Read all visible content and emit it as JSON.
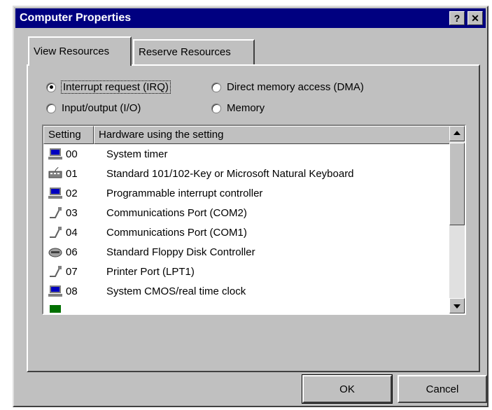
{
  "window": {
    "title": "Computer Properties",
    "help_label": "?",
    "close_label": "✕"
  },
  "tabs": [
    {
      "label": "View Resources",
      "active": true
    },
    {
      "label": "Reserve Resources",
      "active": false
    }
  ],
  "options": {
    "irq": {
      "label": "Interrupt request (IRQ)",
      "selected": true
    },
    "dma": {
      "label": "Direct memory access (DMA)",
      "selected": false
    },
    "io": {
      "label": "Input/output (I/O)",
      "selected": false
    },
    "memory": {
      "label": "Memory",
      "selected": false
    }
  },
  "list": {
    "columns": {
      "setting": "Setting",
      "hardware": "Hardware using the setting"
    },
    "rows": [
      {
        "icon": "computer-icon",
        "code": "00",
        "name": "System timer"
      },
      {
        "icon": "keyboard-icon",
        "code": "01",
        "name": "Standard 101/102-Key or Microsoft Natural Keyboard"
      },
      {
        "icon": "computer-icon",
        "code": "02",
        "name": "Programmable interrupt controller"
      },
      {
        "icon": "port-icon",
        "code": "03",
        "name": "Communications Port (COM2)"
      },
      {
        "icon": "port-icon",
        "code": "04",
        "name": "Communications Port (COM1)"
      },
      {
        "icon": "floppy-icon",
        "code": "06",
        "name": "Standard Floppy Disk Controller"
      },
      {
        "icon": "port-icon",
        "code": "07",
        "name": "Printer Port (LPT1)"
      },
      {
        "icon": "computer-icon",
        "code": "08",
        "name": "System CMOS/real time clock"
      }
    ]
  },
  "buttons": {
    "ok": "OK",
    "cancel": "Cancel"
  },
  "colors": {
    "titlebar": "#000080",
    "face": "#c0c0c0"
  }
}
